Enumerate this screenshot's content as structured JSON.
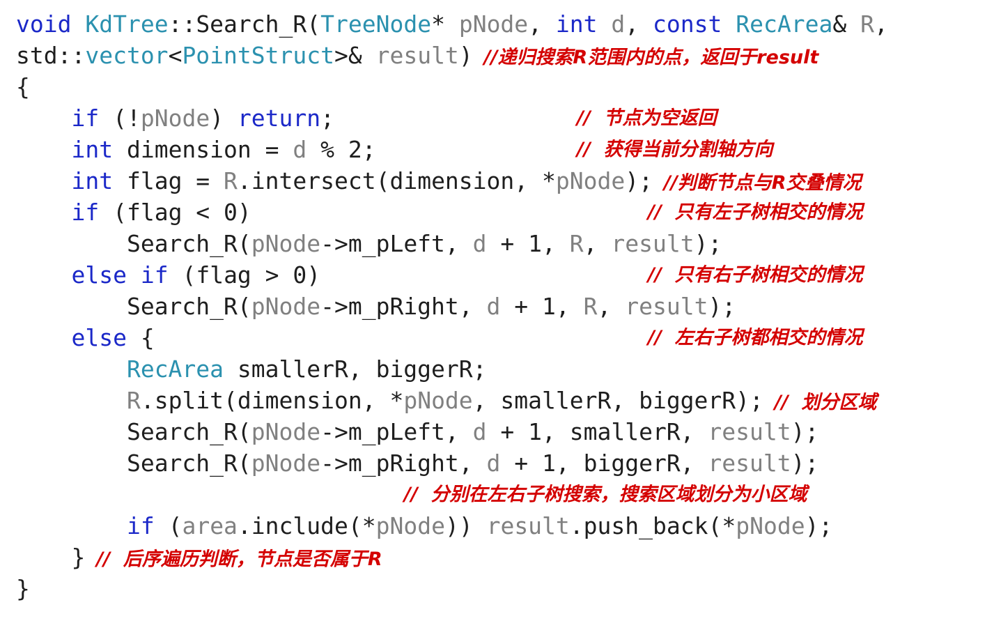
{
  "code": {
    "lines": [
      {
        "indent": 0,
        "tokens": [
          {
            "t": "void",
            "k": "kw"
          },
          {
            "t": " ",
            "k": "pl"
          },
          {
            "t": "KdTree",
            "k": "ty"
          },
          {
            "t": "::Search_R(",
            "k": "pl"
          },
          {
            "t": "TreeNode",
            "k": "ty"
          },
          {
            "t": "* ",
            "k": "pl"
          },
          {
            "t": "pNode",
            "k": "pr"
          },
          {
            "t": ", ",
            "k": "pl"
          },
          {
            "t": "int",
            "k": "kw"
          },
          {
            "t": " ",
            "k": "pl"
          },
          {
            "t": "d",
            "k": "pr"
          },
          {
            "t": ", ",
            "k": "pl"
          },
          {
            "t": "const",
            "k": "kw"
          },
          {
            "t": " ",
            "k": "pl"
          },
          {
            "t": "RecArea",
            "k": "ty"
          },
          {
            "t": "& ",
            "k": "pl"
          },
          {
            "t": "R",
            "k": "pr"
          },
          {
            "t": ",",
            "k": "pl"
          }
        ],
        "comment": ""
      },
      {
        "indent": 0,
        "tokens": [
          {
            "t": "std::",
            "k": "pl"
          },
          {
            "t": "vector",
            "k": "ty"
          },
          {
            "t": "<",
            "k": "pl"
          },
          {
            "t": "PointStruct",
            "k": "ty"
          },
          {
            "t": ">& ",
            "k": "pl"
          },
          {
            "t": "result",
            "k": "pr"
          },
          {
            "t": ")",
            "k": "pl"
          }
        ],
        "comment": "//递归搜索R范围内的点，返回于result",
        "comment_style": "inline"
      },
      {
        "indent": 0,
        "tokens": [
          {
            "t": "{",
            "k": "pl"
          }
        ],
        "comment": ""
      },
      {
        "indent": 1,
        "tokens": [
          {
            "t": "if",
            "k": "kw"
          },
          {
            "t": " (!",
            "k": "pl"
          },
          {
            "t": "pNode",
            "k": "pr"
          },
          {
            "t": ") ",
            "k": "pl"
          },
          {
            "t": "return",
            "k": "kw"
          },
          {
            "t": ";",
            "k": "pl"
          }
        ],
        "comment": "//  节点为空返回",
        "comment_col": "mid"
      },
      {
        "indent": 1,
        "tokens": [
          {
            "t": "int",
            "k": "kw"
          },
          {
            "t": " dimension = ",
            "k": "pl"
          },
          {
            "t": "d",
            "k": "pr"
          },
          {
            "t": " % 2;",
            "k": "pl"
          }
        ],
        "comment": "//  获得当前分割轴方向",
        "comment_col": "mid"
      },
      {
        "indent": 1,
        "tokens": [
          {
            "t": "int",
            "k": "kw"
          },
          {
            "t": " flag = ",
            "k": "pl"
          },
          {
            "t": "R",
            "k": "pr"
          },
          {
            "t": ".intersect(dimension, *",
            "k": "pl"
          },
          {
            "t": "pNode",
            "k": "pr"
          },
          {
            "t": ");",
            "k": "pl"
          }
        ],
        "comment": "//判断节点与R交叠情况",
        "comment_style": "inline"
      },
      {
        "indent": 1,
        "tokens": [
          {
            "t": "if",
            "k": "kw"
          },
          {
            "t": " (flag < 0)",
            "k": "pl"
          }
        ],
        "comment": "//  只有左子树相交的情况",
        "comment_col": "right"
      },
      {
        "indent": 2,
        "tokens": [
          {
            "t": "Search_R(",
            "k": "pl"
          },
          {
            "t": "pNode",
            "k": "pr"
          },
          {
            "t": "->m_pLeft, ",
            "k": "pl"
          },
          {
            "t": "d",
            "k": "pr"
          },
          {
            "t": " + 1, ",
            "k": "pl"
          },
          {
            "t": "R",
            "k": "pr"
          },
          {
            "t": ", ",
            "k": "pl"
          },
          {
            "t": "result",
            "k": "pr"
          },
          {
            "t": ");",
            "k": "pl"
          }
        ],
        "comment": ""
      },
      {
        "indent": 1,
        "tokens": [
          {
            "t": "else",
            "k": "kw"
          },
          {
            "t": " ",
            "k": "pl"
          },
          {
            "t": "if",
            "k": "kw"
          },
          {
            "t": " (flag > 0)",
            "k": "pl"
          }
        ],
        "comment": "//  只有右子树相交的情况",
        "comment_col": "right"
      },
      {
        "indent": 2,
        "tokens": [
          {
            "t": "Search_R(",
            "k": "pl"
          },
          {
            "t": "pNode",
            "k": "pr"
          },
          {
            "t": "->m_pRight, ",
            "k": "pl"
          },
          {
            "t": "d",
            "k": "pr"
          },
          {
            "t": " + 1, ",
            "k": "pl"
          },
          {
            "t": "R",
            "k": "pr"
          },
          {
            "t": ", ",
            "k": "pl"
          },
          {
            "t": "result",
            "k": "pr"
          },
          {
            "t": ");",
            "k": "pl"
          }
        ],
        "comment": ""
      },
      {
        "indent": 1,
        "tokens": [
          {
            "t": "else",
            "k": "kw"
          },
          {
            "t": " {",
            "k": "pl"
          }
        ],
        "comment": "//  左右子树都相交的情况",
        "comment_col": "right"
      },
      {
        "indent": 2,
        "tokens": [
          {
            "t": "RecArea",
            "k": "ty"
          },
          {
            "t": " smallerR, biggerR;",
            "k": "pl"
          }
        ],
        "comment": ""
      },
      {
        "indent": 2,
        "tokens": [
          {
            "t": "R",
            "k": "pr"
          },
          {
            "t": ".split(dimension, *",
            "k": "pl"
          },
          {
            "t": "pNode",
            "k": "pr"
          },
          {
            "t": ", smallerR, biggerR);",
            "k": "pl"
          }
        ],
        "comment": "//  划分区域",
        "comment_style": "inline"
      },
      {
        "indent": 2,
        "tokens": [
          {
            "t": "Search_R(",
            "k": "pl"
          },
          {
            "t": "pNode",
            "k": "pr"
          },
          {
            "t": "->m_pLeft, ",
            "k": "pl"
          },
          {
            "t": "d",
            "k": "pr"
          },
          {
            "t": " + 1, smallerR, ",
            "k": "pl"
          },
          {
            "t": "result",
            "k": "pr"
          },
          {
            "t": ");",
            "k": "pl"
          }
        ],
        "comment": ""
      },
      {
        "indent": 2,
        "tokens": [
          {
            "t": "Search_R(",
            "k": "pl"
          },
          {
            "t": "pNode",
            "k": "pr"
          },
          {
            "t": "->m_pRight, ",
            "k": "pl"
          },
          {
            "t": "d",
            "k": "pr"
          },
          {
            "t": " + 1, biggerR, ",
            "k": "pl"
          },
          {
            "t": "result",
            "k": "pr"
          },
          {
            "t": ");",
            "k": "pl"
          }
        ],
        "comment": ""
      },
      {
        "indent": 0,
        "tokens": [],
        "comment": "//  分别在左右子树搜索，搜索区域划分为小区域",
        "comment_col": "far"
      },
      {
        "indent": 2,
        "tokens": [
          {
            "t": "if",
            "k": "kw"
          },
          {
            "t": " (",
            "k": "pl"
          },
          {
            "t": "area",
            "k": "pr"
          },
          {
            "t": ".include(*",
            "k": "pl"
          },
          {
            "t": "pNode",
            "k": "pr"
          },
          {
            "t": ")) ",
            "k": "pl"
          },
          {
            "t": "result",
            "k": "pr"
          },
          {
            "t": ".push_back(*",
            "k": "pl"
          },
          {
            "t": "pNode",
            "k": "pr"
          },
          {
            "t": ");",
            "k": "pl"
          }
        ],
        "comment": ""
      },
      {
        "indent": 1,
        "tokens": [
          {
            "t": "}",
            "k": "pl"
          }
        ],
        "comment": "//  后序遍历判断，节点是否属于R",
        "comment_style": "inline"
      },
      {
        "indent": 0,
        "tokens": [
          {
            "t": "}",
            "k": "pl"
          }
        ],
        "comment": ""
      }
    ]
  }
}
